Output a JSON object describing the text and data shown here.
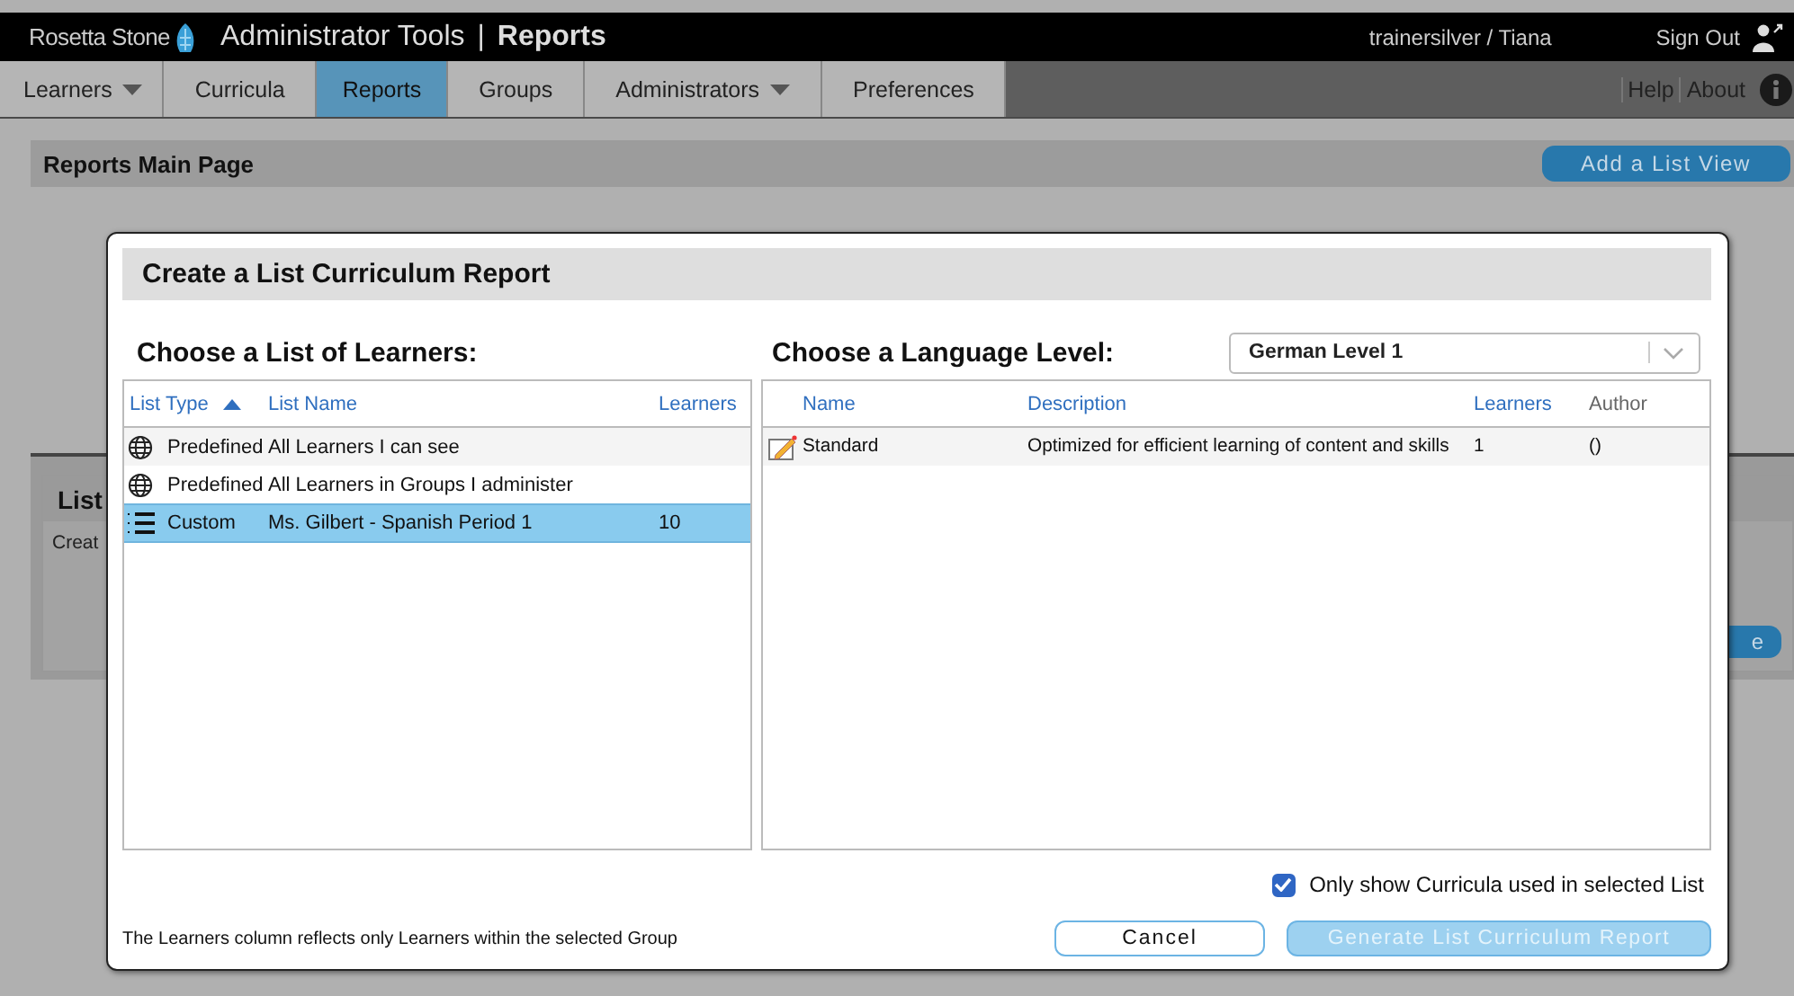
{
  "header": {
    "brand": "Rosetta Stone",
    "app_title": "Administrator Tools",
    "separator": "|",
    "section": "Reports",
    "user": "trainersilver / Tiana",
    "sign_out": "Sign Out"
  },
  "nav": {
    "tabs": [
      {
        "label": "Learners",
        "dropdown": true,
        "selected": false
      },
      {
        "label": "Curricula",
        "dropdown": false,
        "selected": false
      },
      {
        "label": "Reports",
        "dropdown": false,
        "selected": true
      },
      {
        "label": "Groups",
        "dropdown": false,
        "selected": false
      },
      {
        "label": "Administrators",
        "dropdown": true,
        "selected": false
      },
      {
        "label": "Preferences",
        "dropdown": false,
        "selected": false
      }
    ],
    "links": [
      "Help",
      "About"
    ]
  },
  "page": {
    "title": "Reports Main Page",
    "add_button": "Add a List View",
    "panel": {
      "title": "List",
      "text": "Creat",
      "button": "e"
    }
  },
  "dialog": {
    "title": "Create a List Curriculum Report",
    "learners_heading": "Choose a List of Learners:",
    "learners_columns": [
      {
        "label": "List Type",
        "sorted": true
      },
      {
        "label": "List Name",
        "sorted": false
      },
      {
        "label": "Learners",
        "sorted": false
      }
    ],
    "learners_rows": [
      {
        "kind": "globe",
        "type": "Predefined",
        "name": "All Learners I can see",
        "learners": "",
        "selected": false
      },
      {
        "kind": "globe",
        "type": "Predefined",
        "name": "All Learners in Groups I administer",
        "learners": "",
        "selected": false
      },
      {
        "kind": "list",
        "type": "Custom",
        "name": "Ms. Gilbert - Spanish Period 1",
        "learners": "10",
        "selected": true
      }
    ],
    "level_heading": "Choose a Language Level:",
    "level_select": {
      "value": "German Level 1"
    },
    "curricula_columns": [
      {
        "label": "Name",
        "sortable": true
      },
      {
        "label": "Description",
        "sortable": true
      },
      {
        "label": "Learners",
        "sortable": true
      },
      {
        "label": "Author",
        "sortable": false
      }
    ],
    "curricula_rows": [
      {
        "name": "Standard",
        "description": "Optimized for efficient learning of content and skills",
        "learners": "1",
        "author": "()"
      }
    ],
    "only_used": {
      "label": "Only show Curricula used in selected List",
      "checked": true
    },
    "note": "The Learners column reflects only Learners within the selected Group",
    "cancel": "Cancel",
    "generate": {
      "label": "Generate List Curriculum Report",
      "disabled": true
    }
  }
}
